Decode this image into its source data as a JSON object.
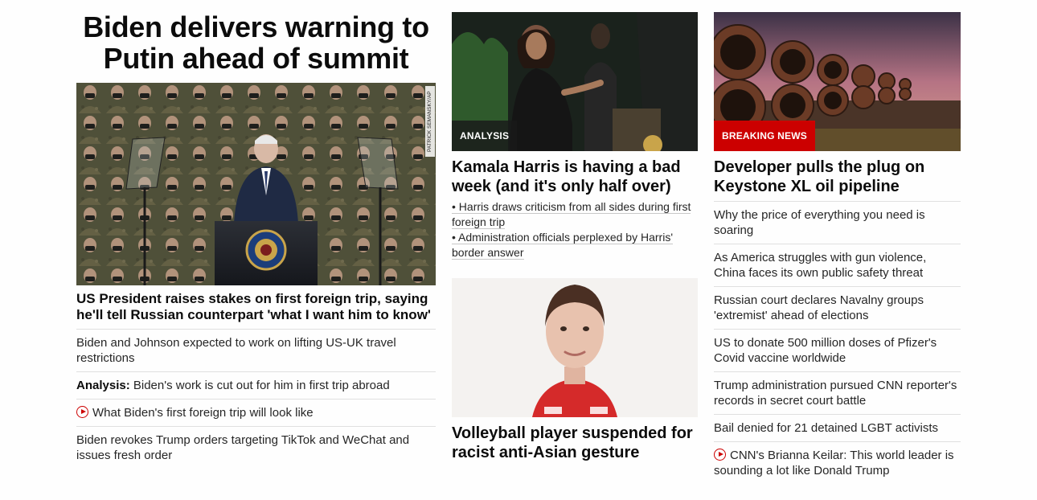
{
  "column1": {
    "title": "Biden delivers warning to Putin ahead of summit",
    "photo_credit": "PATRICK SEMANSKY/AP",
    "headline": "US President raises stakes on first foreign trip, saying he'll tell Russian counterpart 'what I want him to know'",
    "links": [
      {
        "text": "Biden and Johnson expected to work on lifting US-UK travel restrictions"
      },
      {
        "prefix": "Analysis:",
        "text": " Biden's work is cut out for him in first trip abroad"
      },
      {
        "icon": "play-icon",
        "text": "What Biden's first foreign trip will look like"
      },
      {
        "text": "Biden revokes Trump orders targeting TikTok and WeChat and issues fresh order"
      }
    ]
  },
  "column2": {
    "story1": {
      "badge": "ANALYSIS",
      "headline": "Kamala Harris is having a bad week (and it's only half over)",
      "bullets": [
        "• Harris draws criticism from all sides during first foreign trip",
        "• Administration officials perplexed by Harris' border answer"
      ]
    },
    "story2": {
      "headline": "Volleyball player suspended for racist anti-Asian gesture"
    }
  },
  "column3": {
    "badge": "BREAKING NEWS",
    "headline": "Developer pulls the plug on Keystone XL oil pipeline",
    "links": [
      {
        "text": "Why the price of everything you need is soaring"
      },
      {
        "text": "As America struggles with gun violence, China faces its own public safety threat"
      },
      {
        "text": "Russian court declares Navalny groups 'extremist' ahead of elections"
      },
      {
        "text": "US to donate 500 million doses of Pfizer's Covid vaccine worldwide"
      },
      {
        "text": "Trump administration pursued CNN reporter's records in secret court battle"
      },
      {
        "text": "Bail denied for 21 detained LGBT activists"
      },
      {
        "icon": "play-icon",
        "text": "CNN's Brianna Keilar: This world leader is sounding a lot like Donald Trump"
      }
    ]
  },
  "colors": {
    "accent_red": "#cc0000",
    "text": "#0c0c0c",
    "divider": "#e0e0e0"
  }
}
